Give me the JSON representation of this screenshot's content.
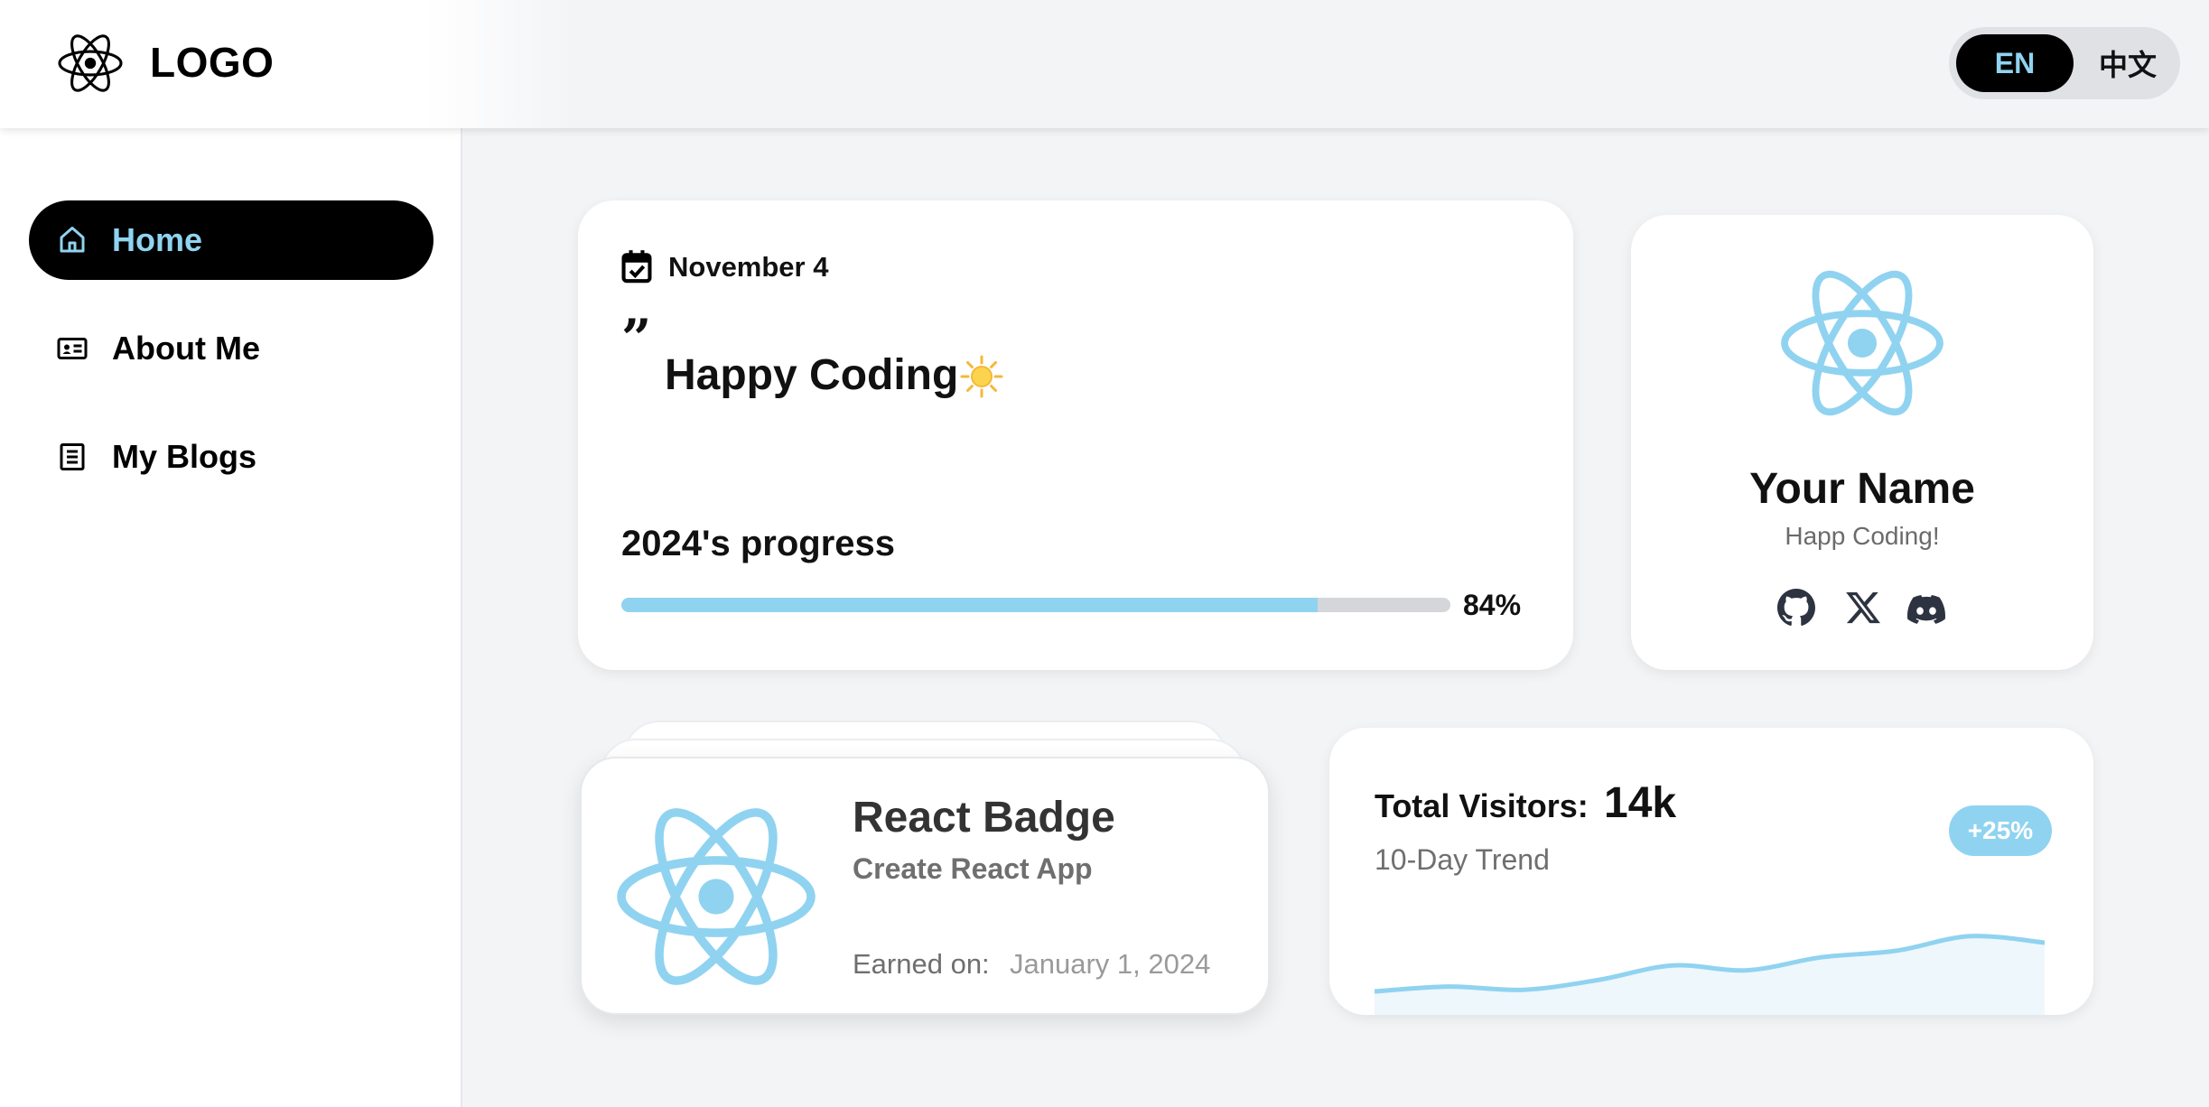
{
  "header": {
    "logo_text": "LOGO",
    "lang_en": "EN",
    "lang_zh": "中文"
  },
  "sidebar": {
    "items": [
      {
        "label": "Home",
        "icon": "home-icon",
        "active": true
      },
      {
        "label": "About Me",
        "icon": "id-card-icon",
        "active": false
      },
      {
        "label": "My Blogs",
        "icon": "document-icon",
        "active": false
      }
    ]
  },
  "quote_card": {
    "date": "November 4",
    "quote": "Happy Coding",
    "progress_title": "2024's progress",
    "progress_value": 0.84,
    "progress_label": "84%"
  },
  "profile": {
    "name": "Your Name",
    "motto": "Happ Coding!",
    "socials": [
      "github-icon",
      "x-icon",
      "discord-icon"
    ]
  },
  "badge": {
    "title": "React Badge",
    "subtitle": "Create React App",
    "earned_label": "Earned on:",
    "earned_date": "January 1, 2024"
  },
  "visitors": {
    "label": "Total Visitors:",
    "value": "14k",
    "trend_label": "10-Day Trend",
    "change": "+25%",
    "trend": [
      2,
      2.6,
      2.2,
      3.4,
      5.2,
      4.6,
      6.2,
      7.0,
      8.8,
      8.0
    ]
  },
  "colors": {
    "accent": "#90d3f0",
    "background": "#f3f4f6",
    "card": "#ffffff",
    "active_nav": "#000000"
  }
}
